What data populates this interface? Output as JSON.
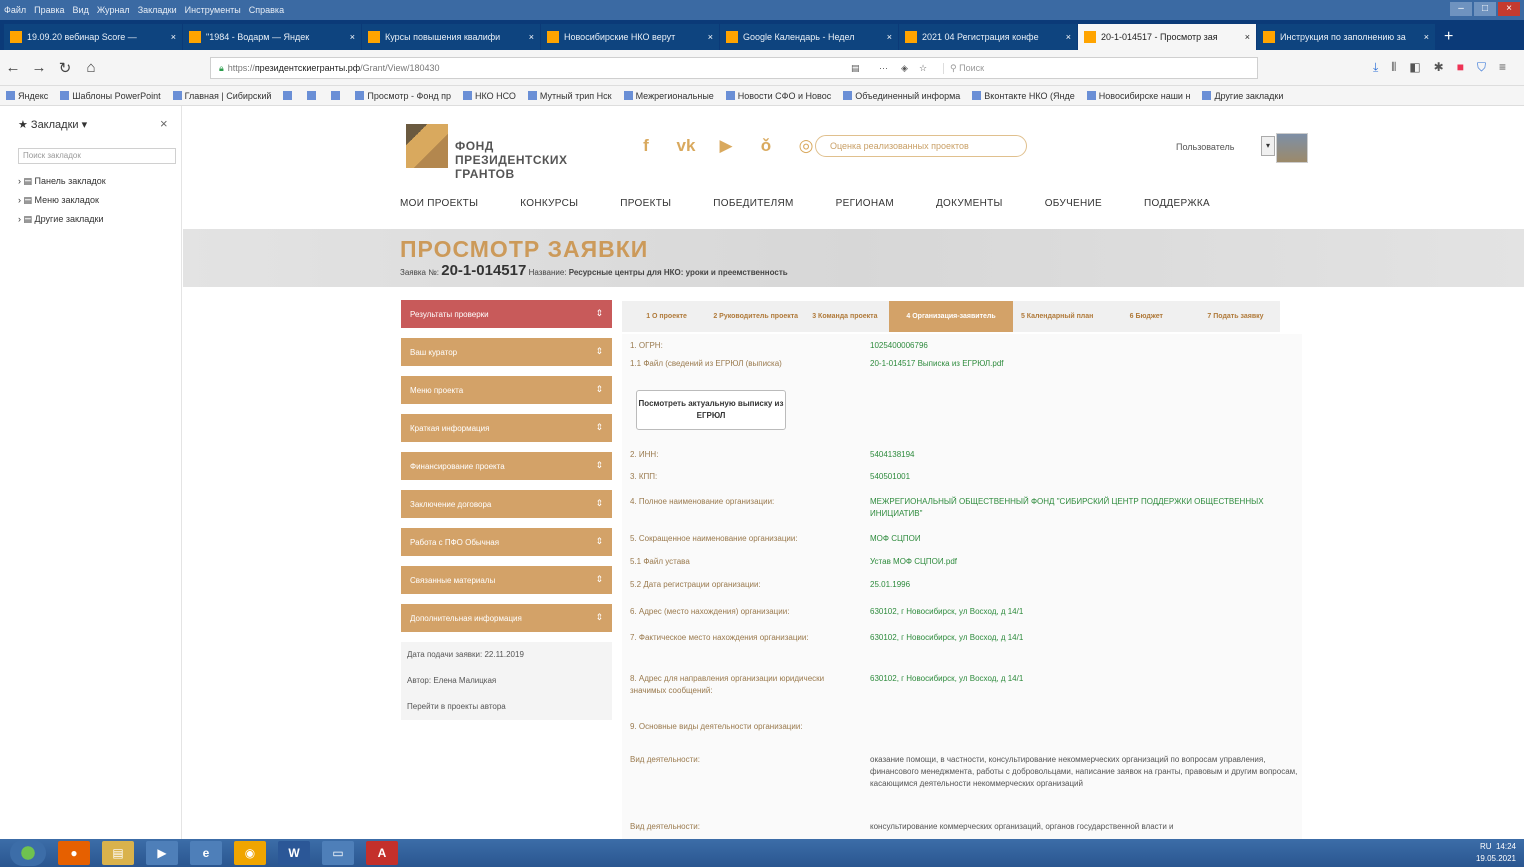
{
  "browser": {
    "menu_items": [
      "Файл",
      "Правка",
      "Вид",
      "Журнал",
      "Закладки",
      "Инструменты",
      "Справка"
    ],
    "tabs": [
      {
        "label": "19.09.20 вебинар Score — ",
        "active": false
      },
      {
        "label": "\"1984 - Водарм — Яндек",
        "active": false
      },
      {
        "label": "Курсы повышения квалифи",
        "active": false
      },
      {
        "label": "Новосибирские НКО верут",
        "active": false
      },
      {
        "label": "Google Календарь - Недел",
        "active": false
      },
      {
        "label": "2021 04 Регистрация конфе",
        "active": false
      },
      {
        "label": "20-1-014517 - Просмотр зая",
        "active": true
      },
      {
        "label": "Инструкция по заполнению за",
        "active": false
      }
    ],
    "url_prefix": "https://",
    "url_host": "президентскиегранты.рф",
    "url_path": "/Grant/View/180430",
    "search_placeholder": "Поиск",
    "bookmarks": [
      "Яндекс",
      "Шаблоны PowerPoint",
      "Главная | Сибирский",
      "",
      "",
      "",
      "Просмотр - Фонд пр",
      "НКО НСО",
      "Мутный трип Нск",
      "Межрегиональные",
      "Новости СФО и Новос",
      "Объединенный информа",
      "Вконтакте НКО (Янде",
      "Новосибирске наши н",
      "Другие закладки"
    ]
  },
  "sidepanel": {
    "title": "Закладки",
    "search_placeholder": "Поиск закладок",
    "items": [
      "Панель закладок",
      "Меню закладок",
      "Другие закладки"
    ]
  },
  "site": {
    "logo_lines": [
      "ФОНД",
      "ПРЕЗИДЕНТСКИХ",
      "ГРАНТОВ"
    ],
    "social_icons": [
      "facebook-icon",
      "vk-icon",
      "youtube-icon",
      "odnoklassniki-icon",
      "instagram-icon"
    ],
    "search_placeholder": "Оценка реализованных проектов",
    "user_label": "Пользователь",
    "nav": [
      "МОИ ПРОЕКТЫ",
      "КОНКУРСЫ",
      "ПРОЕКТЫ",
      "ПОБЕДИТЕЛЯМ",
      "РЕГИОНАМ",
      "ДОКУМЕНТЫ",
      "ОБУЧЕНИЕ",
      "ПОДДЕРЖКА"
    ],
    "page_title": "ПРОСМОТР ЗАЯВКИ",
    "app_prefix": "Заявка №:",
    "app_number": "20-1-014517",
    "app_name_label": "Название:",
    "app_name": "Ресурсные центры для НКО: уроки и преемственность"
  },
  "left_menu": {
    "items": [
      "Результаты проверки",
      "Ваш куратор",
      "Меню проекта",
      "Краткая информация",
      "Финансирование проекта",
      "Заключение договора",
      "Работа с ПФО Обычная",
      "Связанные материалы",
      "Дополнительная информация"
    ],
    "info": [
      "Дата подачи заявки: 22.11.2019",
      "Автор: Елена Малицкая",
      "Перейти в проекты автора"
    ]
  },
  "steps": [
    "1 О проекте",
    "2 Руководитель проекта",
    "3 Команда проекта",
    "4 Организация-заявитель",
    "5 Календарный план",
    "6 Бюджет",
    "7 Подать заявку"
  ],
  "form": {
    "button_egrul": "Посмотреть актуальную выписку из ЕГРЮЛ",
    "rows": [
      {
        "label": "1. ОГРН:",
        "value": "1025400006796"
      },
      {
        "label": "1.1 Файл (сведений из ЕГРЮЛ (выписка)",
        "value": "20-1-014517 Выписка из ЕГРЮЛ.pdf"
      },
      {
        "label": "2. ИНН:",
        "value": "5404138194"
      },
      {
        "label": "3. КПП:",
        "value": "540501001"
      },
      {
        "label": "4. Полное наименование организации:",
        "value": "МЕЖРЕГИОНАЛЬНЫЙ ОБЩЕСТВЕННЫЙ ФОНД \"СИБИРСКИЙ ЦЕНТР ПОДДЕРЖКИ ОБЩЕСТВЕННЫХ ИНИЦИАТИВ\""
      },
      {
        "label": "5. Сокращенное наименование организации:",
        "value": "МОФ СЦПОИ"
      },
      {
        "label": "5.1 Файл устава",
        "value": "Устав МОФ СЦПОИ.pdf"
      },
      {
        "label": "5.2 Дата регистрации организации:",
        "value": "25.01.1996"
      },
      {
        "label": "6. Адрес (место нахождения) организации:",
        "value": "630102, г Новосибирск, ул Восход, д 14/1"
      },
      {
        "label": "7. Фактическое место нахождения организации:",
        "value": "630102, г Новосибирск, ул Восход, д 14/1"
      },
      {
        "label": "8. Адрес для направления организации юридически значимых сообщений:",
        "value": "630102, г Новосибирск, ул Восход, д 14/1"
      },
      {
        "label": "9. Основные виды деятельности организации:",
        "value": ""
      },
      {
        "label": "Вид деятельности:",
        "value": "оказание помощи, в частности, консультирование некоммерческих организаций по вопросам управления, финансового менеджмента, работы с добровольцами, написание заявок на гранты, правовым и другим вопросам, касающимся деятельности некоммерческих организаций"
      },
      {
        "label": "Вид деятельности:",
        "value": "консультирование коммерческих организаций, органов государственной власти и"
      }
    ]
  },
  "taskbar": {
    "time": "14:24",
    "date": "19.05.2021",
    "lang": "RU"
  }
}
